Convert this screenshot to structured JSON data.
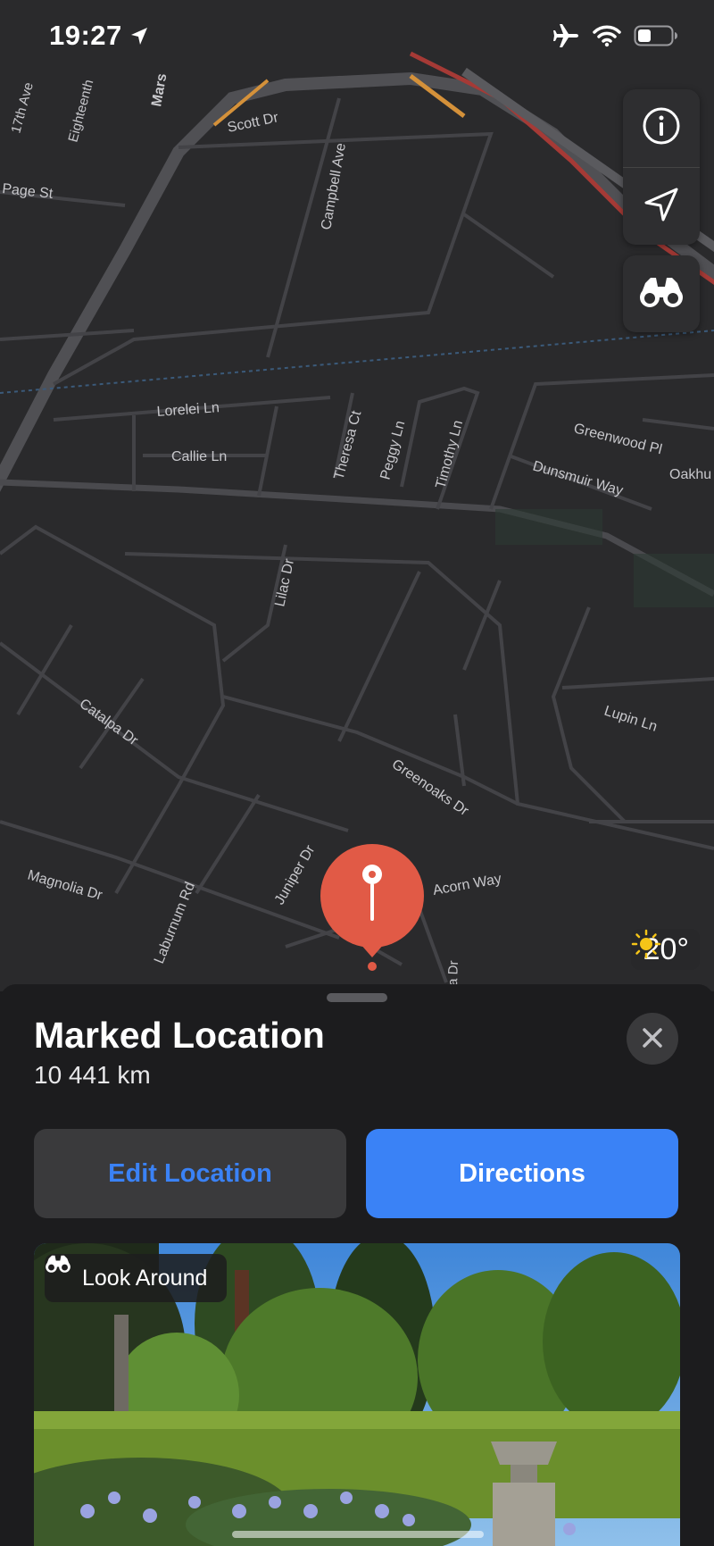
{
  "status_bar": {
    "time": "19:27",
    "icons": [
      "location-arrow-icon",
      "airplane-icon",
      "wifi-icon",
      "battery-icon"
    ]
  },
  "map": {
    "street_labels": [
      "17th Ave",
      "Eighteenth",
      "Mars",
      "Scott Dr",
      "Page St",
      "Campbell Ave",
      "Lorelei Ln",
      "Callie Ln",
      "Theresa Ct",
      "Peggy Ln",
      "Timothy Ln",
      "Greenwood Pl",
      "Dunsmuir Way",
      "Oakhu",
      "Lilac Dr",
      "Catalpa Dr",
      "Lupin Ln",
      "Greenoaks Dr",
      "Juniper Dr",
      "Acorn Way",
      "Magnolia Dr",
      "Laburnum Rd",
      "a Dr"
    ],
    "controls": [
      "info-icon",
      "location-arrow-icon",
      "binoculars-icon"
    ],
    "weather": {
      "icon": "sun-icon",
      "temperature": "20°"
    },
    "pin_color": "#e15a46"
  },
  "sheet": {
    "title": "Marked Location",
    "distance": "10 441 km",
    "edit_label": "Edit Location",
    "directions_label": "Directions",
    "look_around_label": "Look Around",
    "accent": "#3a82f6"
  }
}
